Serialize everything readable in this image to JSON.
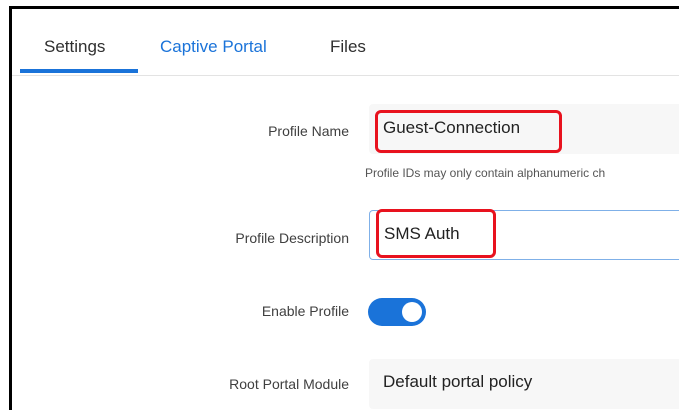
{
  "tabs": [
    {
      "label": "Settings",
      "active": true
    },
    {
      "label": "Captive Portal",
      "active": false
    },
    {
      "label": "Files",
      "active": false
    }
  ],
  "form": {
    "profile_name": {
      "label": "Profile Name",
      "value": "Guest-Connection",
      "helper": "Profile IDs may only contain alphanumeric ch"
    },
    "profile_description": {
      "label": "Profile Description",
      "value": "SMS Auth"
    },
    "enable_profile": {
      "label": "Enable Profile",
      "enabled": true
    },
    "root_portal_module": {
      "label": "Root Portal Module",
      "value": "Default portal policy"
    }
  },
  "colors": {
    "accent": "#1a73d9",
    "highlight": "#e8121e",
    "field_bg": "#f7f7f7"
  }
}
